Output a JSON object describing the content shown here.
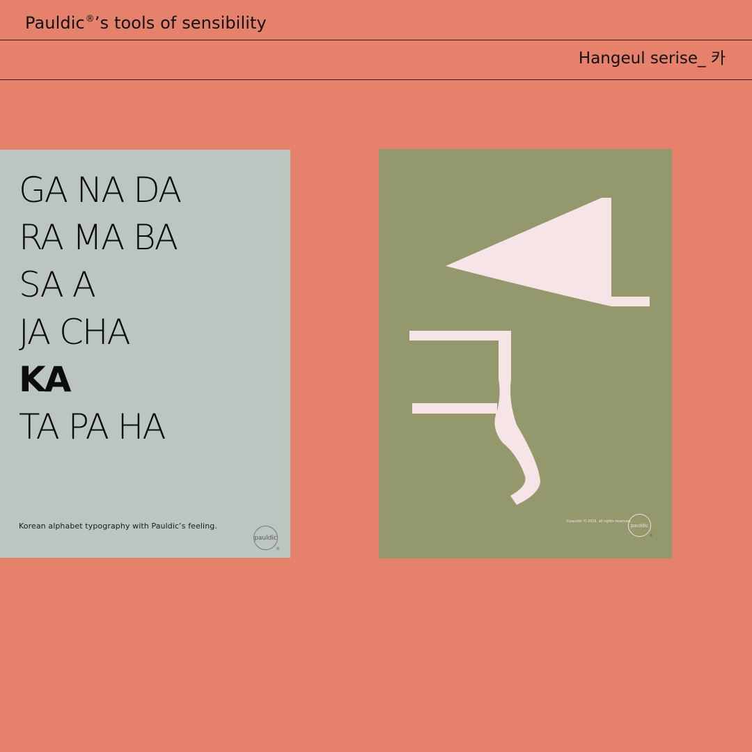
{
  "header": {
    "brand_name": "Pauldic",
    "registered_mark": "®",
    "brand_suffix": "’s tools of sensibility",
    "series_title": "Hangeul serise_ 카"
  },
  "left_poster": {
    "lines": [
      "GA NA DA",
      "RA MA BA",
      "SA A",
      "JA CHA",
      "KA",
      "TA PA HA"
    ],
    "highlighted_line": "KA",
    "caption": "Korean alphabet typography with Pauldic’s feeling.",
    "logo_text": "pauldic",
    "logo_mark": "®"
  },
  "right_poster": {
    "glyph": "카",
    "copyright": "©pauldic 카 2016. all rights reserved.",
    "logo_text": "pauldic",
    "logo_mark": "®"
  },
  "colors": {
    "background": "#E6826C",
    "left_poster": "#BCC6C1",
    "right_poster": "#94986D",
    "glyph": "#F7E4E6"
  }
}
